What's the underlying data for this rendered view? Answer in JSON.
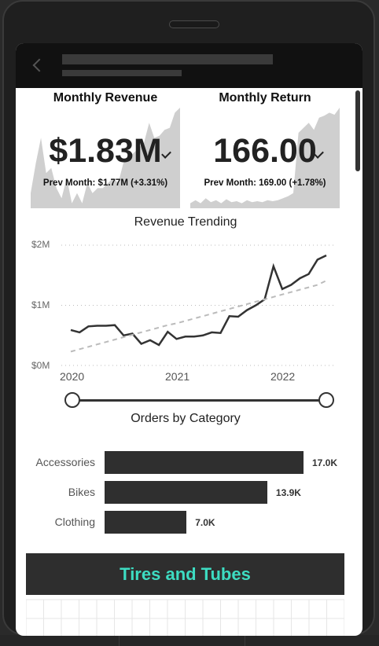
{
  "header": {
    "back_icon": "chevron-left-icon"
  },
  "kpi_revenue": {
    "title": "Monthly Revenue",
    "value": "$1.83M",
    "prev": "Prev Month: $1.77M (+3.31%)",
    "status_icon": "checkmark-icon"
  },
  "kpi_return": {
    "title": "Monthly Return",
    "value": "166.00",
    "prev": "Prev Month: 169.00 (+1.78%)",
    "status_icon": "checkmark-icon"
  },
  "revenue_trending": {
    "title": "Revenue Trending",
    "y_labels": [
      "$2M",
      "$1M",
      "$0M"
    ],
    "x_labels": [
      "2020",
      "2021",
      "2022"
    ]
  },
  "orders_by_category": {
    "title": "Orders by Category",
    "items": [
      {
        "label": "Accessories",
        "value_label": "17.0K"
      },
      {
        "label": "Bikes",
        "value_label": "13.9K"
      },
      {
        "label": "Clothing",
        "value_label": "7.0K"
      }
    ]
  },
  "banner": {
    "label": "Tires and Tubes",
    "color": "#3ddcc2"
  },
  "chart_data": [
    {
      "type": "line",
      "title": "Revenue Trending",
      "x_start": "2020-01",
      "x_ticks": [
        "2020",
        "2021",
        "2022"
      ],
      "ylim": [
        0,
        2000000
      ],
      "y_ticks": [
        "$0M",
        "$1M",
        "$2M"
      ],
      "grid": true,
      "series": [
        {
          "values": [
            590000,
            550000,
            650000,
            660000,
            660000,
            670000,
            500000,
            530000,
            360000,
            420000,
            340000,
            560000,
            440000,
            480000,
            480000,
            500000,
            550000,
            540000,
            820000,
            810000,
            920000,
            1000000,
            1100000,
            1650000,
            1270000,
            1340000,
            1450000,
            1520000,
            1760000,
            1830000
          ]
        },
        {
          "values": [
            230000,
            270000,
            310000,
            350000,
            390000,
            430000,
            470000,
            510000,
            550000,
            590000,
            630000,
            670000,
            700000,
            740000,
            780000,
            820000,
            860000,
            900000,
            940000,
            980000,
            1020000,
            1060000,
            1100000,
            1140000,
            1180000,
            1220000,
            1260000,
            1300000,
            1340000,
            1410000
          ]
        }
      ]
    },
    {
      "type": "bar",
      "title": "Orders by Category",
      "categories": [
        "Accessories",
        "Bikes",
        "Clothing"
      ],
      "values": [
        17000,
        13900,
        7000
      ]
    },
    {
      "type": "area",
      "title": "Monthly Revenue",
      "values": [
        0.15,
        0.45,
        0.7,
        0.35,
        0.4,
        0.2,
        0.1,
        0.3,
        0.05,
        0.15,
        0.05,
        0.25,
        0.15,
        0.2,
        0.2,
        0.25,
        0.3,
        0.25,
        0.45,
        0.5,
        0.55,
        0.6,
        0.65,
        0.85,
        0.7,
        0.72,
        0.78,
        0.8,
        0.95,
        1.0
      ]
    },
    {
      "type": "area",
      "title": "Monthly Return",
      "values": [
        0.05,
        0.08,
        0.05,
        0.1,
        0.06,
        0.08,
        0.05,
        0.09,
        0.06,
        0.07,
        0.05,
        0.08,
        0.06,
        0.07,
        0.06,
        0.08,
        0.07,
        0.08,
        0.1,
        0.12,
        0.15,
        0.75,
        0.8,
        0.85,
        0.78,
        0.9,
        0.92,
        0.95,
        0.93,
        1.0
      ]
    }
  ]
}
